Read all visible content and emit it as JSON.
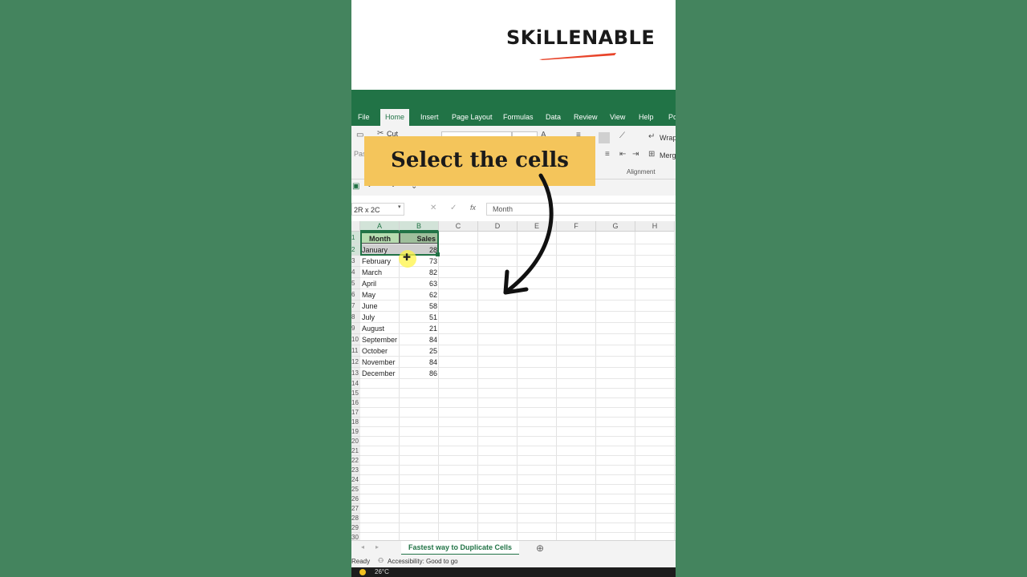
{
  "brand": {
    "logo_text": "SKiLLENABLE",
    "swoosh_color": "#e8442a"
  },
  "ribbon": {
    "tabs": [
      "File",
      "Home",
      "Insert",
      "Page Layout",
      "Formulas",
      "Data",
      "Review",
      "View",
      "Help",
      "Po"
    ],
    "active_tab": "Home",
    "cut_label": "Cut",
    "paste_label": "Pas",
    "wrap_label": "Wrap",
    "merge_label": "Merg",
    "alignment_group": "Alignment"
  },
  "callout": {
    "text": "Select the cells",
    "color": "#f4c55b"
  },
  "formula_bar": {
    "name_box": "2R x 2C",
    "formula": "Month",
    "fx_icon": "fx"
  },
  "sheet": {
    "columns": [
      "A",
      "B",
      "C",
      "D",
      "E",
      "F",
      "G",
      "H"
    ],
    "row_numbers": [
      "1",
      "2",
      "3",
      "4",
      "5",
      "6",
      "7",
      "8",
      "9",
      "10",
      "11",
      "12",
      "13",
      "14",
      "15",
      "16",
      "17",
      "18",
      "19",
      "20",
      "21",
      "22",
      "23",
      "24",
      "25",
      "26",
      "27",
      "28",
      "29",
      "30"
    ],
    "header": {
      "month": "Month",
      "sales": "Sales"
    },
    "rows": [
      {
        "month": "January",
        "sales": "28"
      },
      {
        "month": "February",
        "sales": "73"
      },
      {
        "month": "March",
        "sales": "82"
      },
      {
        "month": "April",
        "sales": "63"
      },
      {
        "month": "May",
        "sales": "62"
      },
      {
        "month": "June",
        "sales": "58"
      },
      {
        "month": "July",
        "sales": "51"
      },
      {
        "month": "August",
        "sales": "21"
      },
      {
        "month": "September",
        "sales": "84"
      },
      {
        "month": "October",
        "sales": "25"
      },
      {
        "month": "November",
        "sales": "84"
      },
      {
        "month": "December",
        "sales": "86"
      }
    ],
    "tab_name": "Fastest way to Duplicate Cells",
    "add_sheet_icon": "⊕"
  },
  "status_bar": {
    "ready": "Ready",
    "accessibility": "Accessibility: Good to go"
  },
  "taskbar": {
    "weather": "26°C"
  },
  "colors": {
    "excel_green": "#217346",
    "background": "#44845e"
  }
}
